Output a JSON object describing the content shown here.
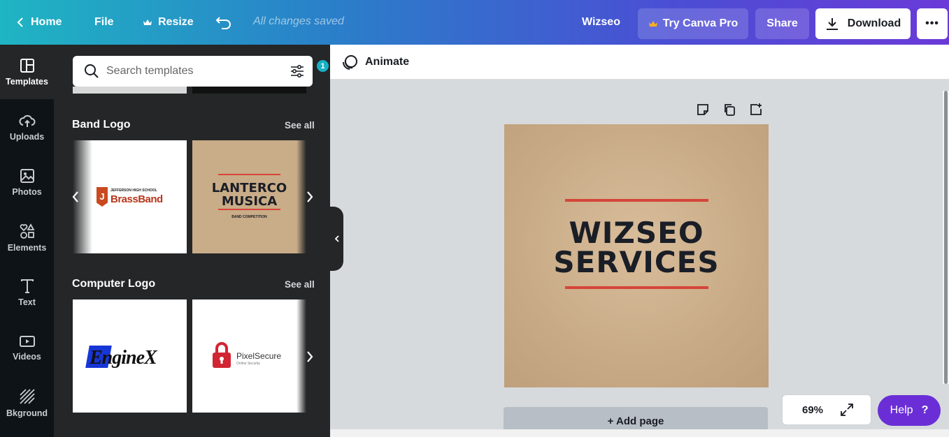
{
  "topbar": {
    "home": "Home",
    "file": "File",
    "resize": "Resize",
    "saved_status": "All changes saved",
    "doc_name": "Wizseo",
    "try_pro": "Try Canva Pro",
    "share": "Share",
    "download": "Download",
    "more": "•••"
  },
  "rail": [
    {
      "label": "Templates",
      "icon": "templates-icon"
    },
    {
      "label": "Uploads",
      "icon": "cloud-upload-icon"
    },
    {
      "label": "Photos",
      "icon": "image-icon"
    },
    {
      "label": "Elements",
      "icon": "shapes-icon"
    },
    {
      "label": "Text",
      "icon": "text-icon"
    },
    {
      "label": "Videos",
      "icon": "video-icon"
    },
    {
      "label": "Bkground",
      "icon": "pattern-icon"
    }
  ],
  "search": {
    "placeholder": "Search templates",
    "filter_count": "1"
  },
  "sections": [
    {
      "title": "Band Logo",
      "see_all": "See all",
      "templates": [
        {
          "subtitle": "JEFFERSON HIGH SCHOOL",
          "title": "BrassBand",
          "mark": "J"
        },
        {
          "line1": "LANTERCO",
          "line2": "MUSICA",
          "sub": "BAND COMPETITION"
        }
      ]
    },
    {
      "title": "Computer Logo",
      "see_all": "See all",
      "templates": [
        {
          "title": "EngineX"
        },
        {
          "title": "PixelSecure",
          "sub": "Online Security"
        }
      ]
    }
  ],
  "editor": {
    "animate": "Animate",
    "canvas_line1": "WIZSEO",
    "canvas_line2": "SERVICES",
    "add_page": "+ Add page",
    "zoom": "69%",
    "help": "Help",
    "help_icon": "?"
  },
  "colors": {
    "canvas_bg": "#c8aa86",
    "accent_red": "#d6453a",
    "help_purple": "#6b2ed6"
  }
}
